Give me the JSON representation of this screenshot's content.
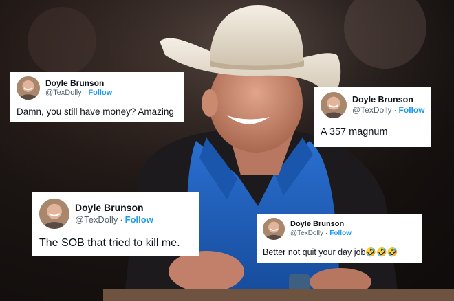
{
  "tweets": [
    {
      "name": "Doyle Brunson",
      "handle": "@TexDolly",
      "separator": "·",
      "follow_label": "Follow",
      "text": "Damn, you still have money? Amazing"
    },
    {
      "name": "Doyle Brunson",
      "handle": "@TexDolly",
      "separator": "·",
      "follow_label": "Follow",
      "text": "A 357 magnum"
    },
    {
      "name": "Doyle Brunson",
      "handle": "@TexDolly",
      "separator": "·",
      "follow_label": "Follow",
      "text": "The SOB that tried to kill me."
    },
    {
      "name": "Doyle Brunson",
      "handle": "@TexDolly",
      "separator": "·",
      "follow_label": "Follow",
      "text": "Better not quit your day job🤣🤣🤣"
    }
  ],
  "colors": {
    "follow": "#1d9bf0",
    "handle": "#536471",
    "text": "#0f1419",
    "shirt": "#1f5fb8",
    "hat": "#ece3d4"
  },
  "icons": {
    "avatar": "profile-photo-icon"
  }
}
